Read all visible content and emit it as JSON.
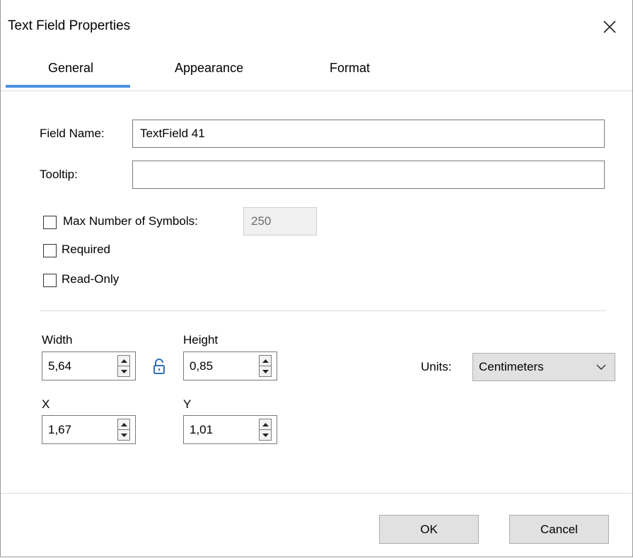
{
  "window": {
    "title": "Text Field Properties"
  },
  "tabs": [
    {
      "label": "General",
      "active": true
    },
    {
      "label": "Appearance",
      "active": false
    },
    {
      "label": "Format",
      "active": false
    }
  ],
  "general": {
    "field_name_label": "Field Name:",
    "field_name_value": "TextField 41",
    "tooltip_label": "Tooltip:",
    "tooltip_value": "",
    "max_symbols_label": "Max Number of Symbols:",
    "max_symbols_value": "250",
    "max_symbols_checked": false,
    "required_label": "Required",
    "required_checked": false,
    "readonly_label": "Read-Only",
    "readonly_checked": false
  },
  "dimensions": {
    "width_label": "Width",
    "width_value": "5,64",
    "height_label": "Height",
    "height_value": "0,85",
    "x_label": "X",
    "x_value": "1,67",
    "y_label": "Y",
    "y_value": "1,01",
    "units_label": "Units:",
    "units_value": "Centimeters"
  },
  "footer": {
    "ok_label": "OK",
    "cancel_label": "Cancel"
  },
  "colors": {
    "accent": "#4a90e2",
    "button_bg": "#e1e1e1",
    "disabled_bg": "#f0f0f0",
    "lock_icon": "#2f6fb7"
  }
}
